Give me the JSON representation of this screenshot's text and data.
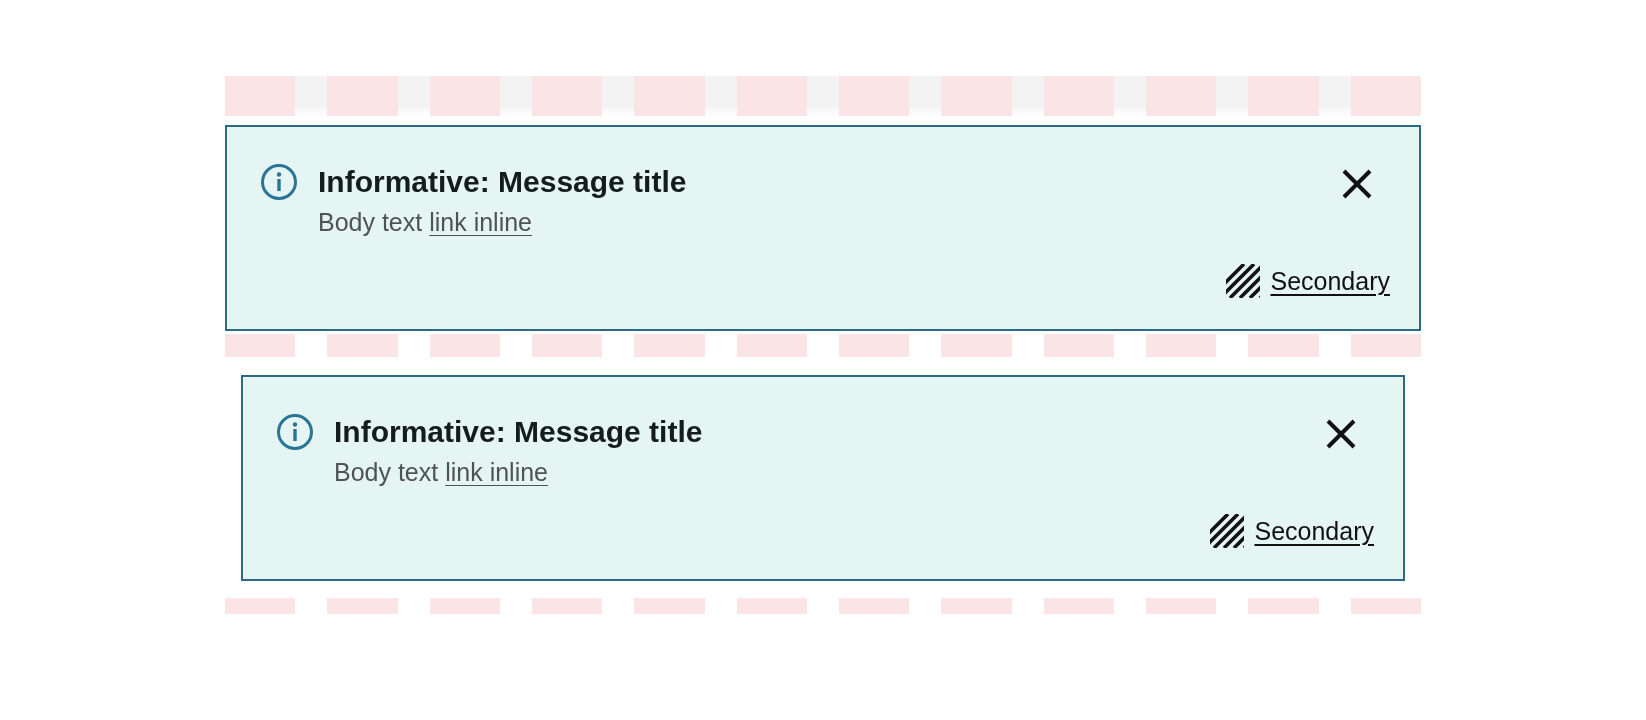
{
  "banners": [
    {
      "title": "Informative: Message title",
      "body": "Body text",
      "link": "link inline",
      "action": "Secondary",
      "inset": false
    },
    {
      "title": "Informative: Message title",
      "body": "Body text",
      "link": "link inline",
      "action": "Secondary",
      "inset": true
    }
  ]
}
